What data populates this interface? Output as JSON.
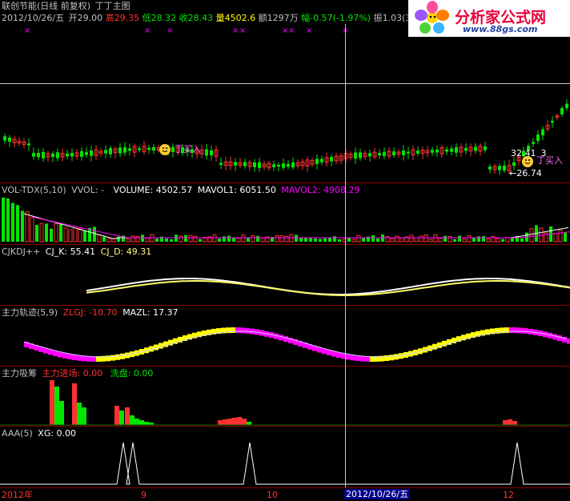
{
  "header": {
    "title": "联创节能(日线 前复权)",
    "title_extra": "丁丁主图",
    "date": "2012/10/26/五",
    "open_label": "开",
    "open": "29.00",
    "high_label": "高",
    "high": "29.35",
    "low_label": "低",
    "low": "28.32",
    "close_label": "收",
    "close": "28.43",
    "volume_label": "量",
    "volume": "4502.6",
    "amount_label": "额",
    "amount": "1297万",
    "change_label": "幅",
    "change": "-0.57(-1.97%)",
    "amplitude_label": "振",
    "amplitude": "1.03(3"
  },
  "main_chart": {
    "price_marker_high": "32.41",
    "price_marker_high_suffix": "3",
    "price_marker_low": "←26.74",
    "buy_label_1": "丁买入",
    "buy_label_2": "丁买入"
  },
  "vol_panel": {
    "title": "VOL-TDX(5,10)",
    "vvol": "VVOL: -",
    "volume": "VOLUME: 4502.57",
    "mavol1": "MAVOL1: 6051.50",
    "mavol2": "MAVOL2: 4908.29"
  },
  "kdj_panel": {
    "title": "CJKDJ++",
    "k": "CJ_K: 55.41",
    "d": "CJ_D: 49.31"
  },
  "track_panel": {
    "title": "主力轨迹(5,9)",
    "zlgj": "ZLGJ: -10.70",
    "mazl": "MAZL: 17.37"
  },
  "absorb_panel": {
    "title": "主力吸筹",
    "entry": "主力进场: 0.00",
    "wash": "洗盘: 0.00"
  },
  "aaa_panel": {
    "title": "AAA(5)",
    "xg": "XG: 0.00"
  },
  "time_axis": {
    "labels": [
      "2012年",
      "9",
      "10",
      "2012/10/26/五",
      "12"
    ]
  },
  "logo": {
    "brand": "分析家公式网",
    "url": "www.88gs.com"
  },
  "colors": {
    "up": "#ff3232",
    "down": "#00e600",
    "yellow": "#ffff00",
    "magenta": "#ff00ff",
    "white": "#ffffff",
    "separator": "#8b0000",
    "cursor": "#c8c8c8"
  }
}
